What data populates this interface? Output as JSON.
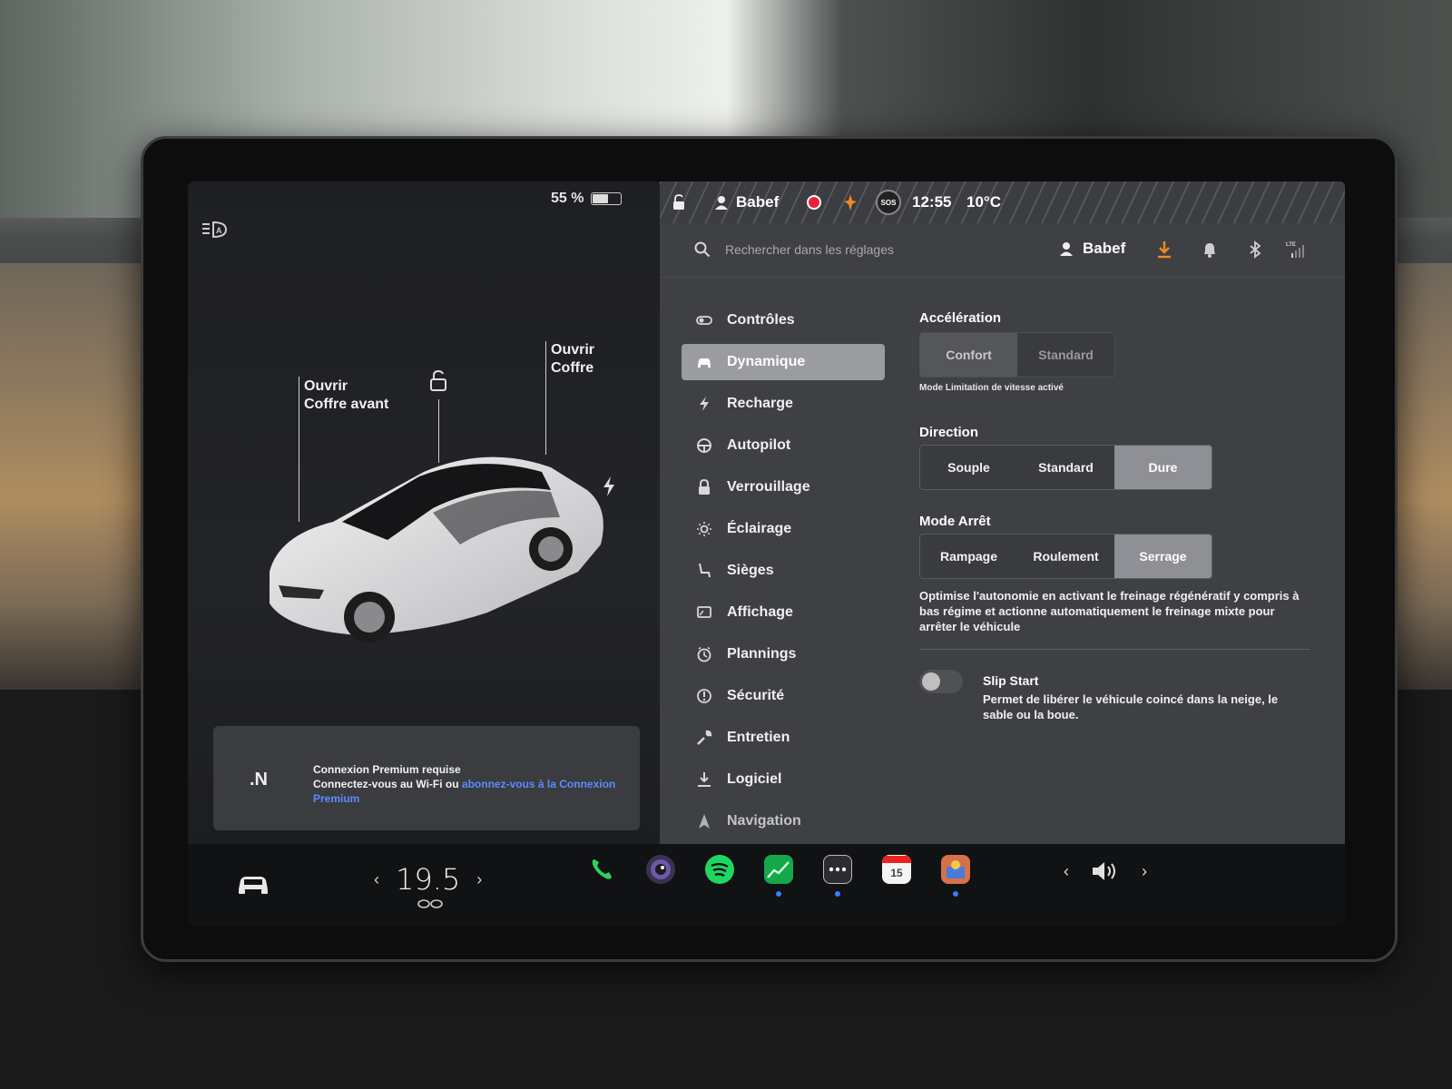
{
  "status_bar": {
    "battery_percent_label": "55 %",
    "battery_level": 0.55,
    "user_name": "Babef",
    "time": "12:55",
    "temperature": "10°C",
    "sos_label": "SOS"
  },
  "car_panel": {
    "front_trunk_line1": "Ouvrir",
    "front_trunk_line2": "Coffre avant",
    "trunk_line1": "Ouvrir",
    "trunk_line2": "Coffre"
  },
  "premium": {
    "title": "Connexion Premium requise",
    "text": "Connectez-vous au Wi-Fi ou ",
    "link": "abonnez-vous à la Connexion Premium"
  },
  "search": {
    "placeholder": "Rechercher dans les réglages",
    "user_name": "Babef"
  },
  "menu": {
    "items": [
      {
        "label": "Contrôles",
        "icon": "toggle-icon"
      },
      {
        "label": "Dynamique",
        "icon": "car-icon"
      },
      {
        "label": "Recharge",
        "icon": "bolt-icon"
      },
      {
        "label": "Autopilot",
        "icon": "steering-wheel-icon"
      },
      {
        "label": "Verrouillage",
        "icon": "lock-icon"
      },
      {
        "label": "Éclairage",
        "icon": "sun-icon"
      },
      {
        "label": "Sièges",
        "icon": "seat-icon"
      },
      {
        "label": "Affichage",
        "icon": "display-icon"
      },
      {
        "label": "Plannings",
        "icon": "clock-icon"
      },
      {
        "label": "Sécurité",
        "icon": "info-circle-icon"
      },
      {
        "label": "Entretien",
        "icon": "wrench-icon"
      },
      {
        "label": "Logiciel",
        "icon": "download-icon"
      },
      {
        "label": "Navigation",
        "icon": "navigation-icon"
      }
    ],
    "active": "Dynamique"
  },
  "dynamics": {
    "acceleration": {
      "title": "Accélération",
      "options": [
        "Confort",
        "Standard"
      ],
      "selected": "Confort",
      "note": "Mode Limitation de vitesse activé"
    },
    "direction": {
      "title": "Direction",
      "options": [
        "Souple",
        "Standard",
        "Dure"
      ],
      "selected": "Dure"
    },
    "stop_mode": {
      "title": "Mode Arrêt",
      "options": [
        "Rampage",
        "Roulement",
        "Serrage"
      ],
      "selected": "Serrage",
      "description": "Optimise l'autonomie en activant le freinage régénératif y compris à bas régime et actionne automatiquement le freinage mixte pour arrêter le véhicule"
    },
    "slip_start": {
      "title": "Slip Start",
      "enabled": false,
      "description": "Permet de libérer le véhicule coincé dans la neige, le sable ou la boue."
    }
  },
  "taskbar": {
    "temperature": "19.5",
    "calendar_day": "15",
    "apps": [
      "phone-icon",
      "camera-icon",
      "spotify-icon",
      "stocks-icon",
      "more-icon",
      "calendar-icon",
      "toybox-icon"
    ]
  },
  "colors": {
    "accent_orange": "#f08a24",
    "record_red": "#e8213b",
    "link_blue": "#5a8cff",
    "phone_green": "#2fd15a",
    "spotify_green": "#1ed760"
  }
}
